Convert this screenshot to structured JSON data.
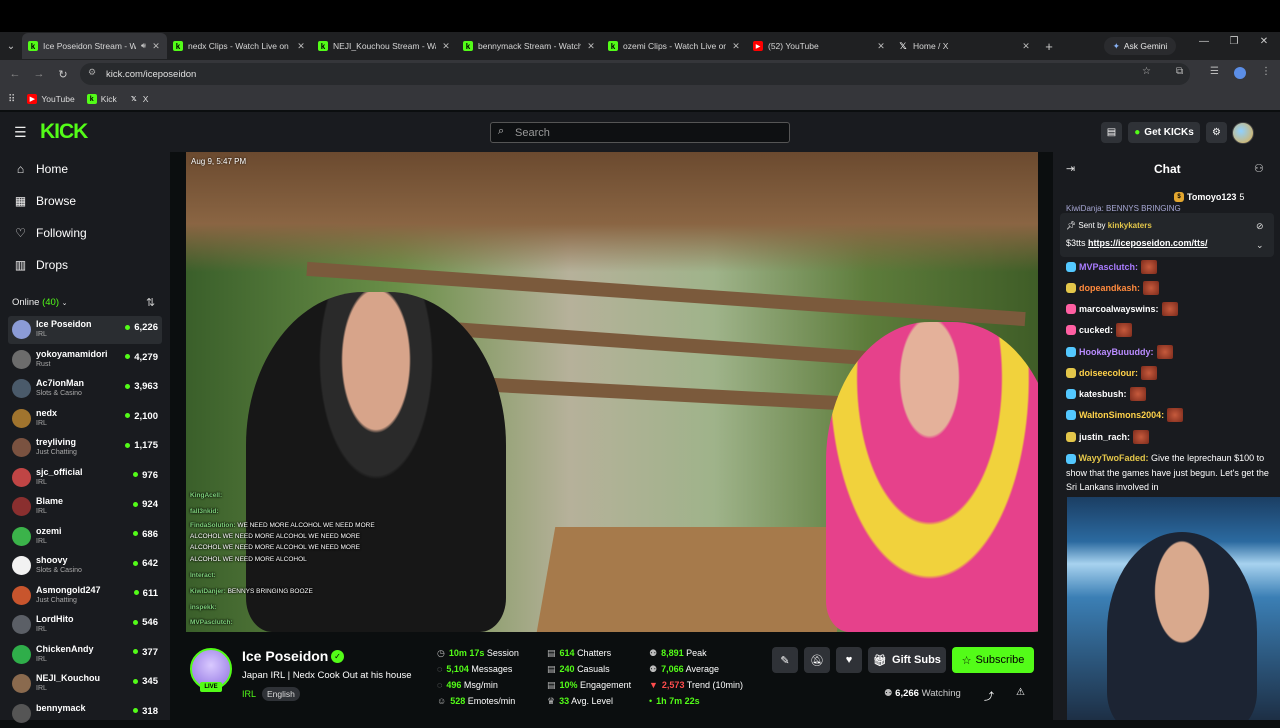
{
  "browser": {
    "tabs": [
      {
        "title": "Ice Poseidon Stream - W",
        "icon": "kick-icon",
        "active": true
      },
      {
        "title": "nedx Clips - Watch Live on K",
        "icon": "kick-icon"
      },
      {
        "title": "NEJI_Kouchou Stream - Wat",
        "icon": "kick-icon"
      },
      {
        "title": "bennymack Stream - Watch",
        "icon": "kick-icon"
      },
      {
        "title": "ozemi Clips - Watch Live on",
        "icon": "kick-icon"
      },
      {
        "title": "(52) YouTube",
        "icon": "youtube-icon"
      },
      {
        "title": "Home / X",
        "icon": "x-icon"
      }
    ],
    "ask_gemini": "Ask Gemini",
    "url": "kick.com/iceposeidon",
    "bookmarks": [
      {
        "label": "YouTube",
        "icon": "youtube-icon"
      },
      {
        "label": "Kick",
        "icon": "kick-icon"
      },
      {
        "label": "X",
        "icon": "x-icon"
      }
    ]
  },
  "header": {
    "logo": "KICK",
    "search_placeholder": "Search",
    "get_kicks": "Get KICKs"
  },
  "sidebar": {
    "nav": [
      {
        "label": "Home",
        "icon": "home-icon"
      },
      {
        "label": "Browse",
        "icon": "browse-icon"
      },
      {
        "label": "Following",
        "icon": "heart-icon"
      },
      {
        "label": "Drops",
        "icon": "drops-icon"
      }
    ],
    "online_label": "Online",
    "online_count": "(40)",
    "channels": [
      {
        "name": "Ice Poseidon",
        "category": "IRL",
        "viewers": "6,226",
        "color": "#8b9bd6"
      },
      {
        "name": "yokoyamamidori",
        "category": "Rust",
        "viewers": "4,279",
        "color": "#6c6c6c"
      },
      {
        "name": "Ac7ionMan",
        "category": "Slots & Casino",
        "viewers": "3,963",
        "color": "#4a5a6a"
      },
      {
        "name": "nedx",
        "category": "IRL",
        "viewers": "2,100",
        "color": "#a0742e"
      },
      {
        "name": "treyliving",
        "category": "Just Chatting",
        "viewers": "1,175",
        "color": "#7a5240"
      },
      {
        "name": "sjc_official",
        "category": "IRL",
        "viewers": "976",
        "color": "#c04545"
      },
      {
        "name": "Blame",
        "category": "IRL",
        "viewers": "924",
        "color": "#8a2f2f"
      },
      {
        "name": "ozemi",
        "category": "IRL",
        "viewers": "686",
        "color": "#3bb34a"
      },
      {
        "name": "shoovy",
        "category": "Slots & Casino",
        "viewers": "642",
        "color": "#f2f2f2"
      },
      {
        "name": "Asmongold247",
        "category": "Just Chatting",
        "viewers": "611",
        "color": "#c8552d"
      },
      {
        "name": "LordHito",
        "category": "IRL",
        "viewers": "546",
        "color": "#5b5f66"
      },
      {
        "name": "ChickenAndy",
        "category": "IRL",
        "viewers": "377",
        "color": "#2fae4a"
      },
      {
        "name": "NEJI_Kouchou",
        "category": "IRL",
        "viewers": "345",
        "color": "#8a6a4e"
      },
      {
        "name": "bennymack",
        "category": "",
        "viewers": "318",
        "color": "#555"
      }
    ]
  },
  "video": {
    "timestamp": "Aug 9, 5:47 PM",
    "overlay_chat": [
      {
        "user": "KingAcell:",
        "text": ""
      },
      {
        "user": "fall3nkid:",
        "text": ""
      },
      {
        "user": "FindaSolution:",
        "text": "WE NEED MORE ALCOHOL WE NEED MORE"
      },
      {
        "user": "",
        "text": "ALCOHOL WE NEED MORE ALCOHOL WE NEED MORE"
      },
      {
        "user": "",
        "text": "ALCOHOL WE NEED MORE ALCOHOL WE NEED MORE"
      },
      {
        "user": "",
        "text": "ALCOHOL WE NEED MORE ALCOHOL"
      },
      {
        "user": "Interact:",
        "text": ""
      },
      {
        "user": "KiwiDanjer:",
        "text": "BENNYS BRINGING BOOZE"
      },
      {
        "user": "inspekk:",
        "text": ""
      },
      {
        "user": "MVPasclutch:",
        "text": ""
      }
    ]
  },
  "stream": {
    "name": "Ice Poseidon",
    "live": "LIVE",
    "title": "Japan IRL | Nedx Cook Out at his house",
    "category": "IRL",
    "language": "English",
    "stats": {
      "session": "10m 17s",
      "session_label": "Session",
      "messages": "5,104",
      "messages_label": "Messages",
      "msg_min": "496",
      "msg_min_label": "Msg/min",
      "emotes_min": "528",
      "emotes_min_label": "Emotes/min",
      "chatters": "614",
      "chatters_label": "Chatters",
      "casuals": "240",
      "casuals_label": "Casuals",
      "engagement": "10%",
      "engagement_label": "Engagement",
      "avg_level": "33",
      "avg_level_label": "Avg. Level",
      "peak": "8,891",
      "peak_label": "Peak",
      "average": "7,066",
      "average_label": "Average",
      "trend": "2,573",
      "trend_label": "Trend (10min)",
      "duration": "1h 7m 22s"
    },
    "gift_subs": "Gift Subs",
    "subscribe": "Subscribe",
    "watching_count": "6,266",
    "watching_label": "Watching"
  },
  "chat": {
    "title": "Chat",
    "top_user": "Tomoyo123",
    "top_count": "5",
    "pinned_sent_by": "Sent by",
    "pinned_user": "kinkykaters",
    "pinned_text": "$3tts",
    "pinned_link": "https://iceposeidon.com/tts/",
    "partial_top": "KiwiDanja: BENNYS BRINGING",
    "messages": [
      {
        "user": "MVPasclutch:",
        "color": "#a97cff",
        "badge": "#53c8ff"
      },
      {
        "user": "dopeandkash:",
        "color": "#ff8a3d",
        "badge": "#e3c64a"
      },
      {
        "user": "marcoalwayswins:",
        "color": "#ffffff",
        "badge": "#ff5fa2"
      },
      {
        "user": "cucked:",
        "color": "#ffffff",
        "badge": "#ff5fa2"
      },
      {
        "user": "HookayBuuuddy:",
        "color": "#b98cff",
        "badge": "#53c8ff"
      },
      {
        "user": "doiseecolour:",
        "color": "#ffd24a",
        "badge": "#e3c64a"
      },
      {
        "user": "katesbush:",
        "color": "#ffffff",
        "badge": "#53c8ff"
      },
      {
        "user": "WaltonSimons2004:",
        "color": "#ffd24a",
        "badge": "#53c8ff"
      },
      {
        "user": "justin_rach:",
        "color": "#ffffff",
        "badge": "#e3c64a"
      }
    ],
    "long_message": {
      "user": "WayyTwoFaded:",
      "text": "Give the leprechaun $100 to show that the games have just begun. Let's get the Sri Lankans involved in"
    }
  }
}
